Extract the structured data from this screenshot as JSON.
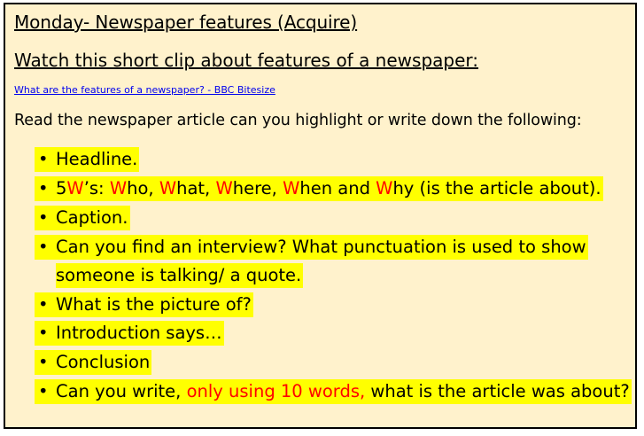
{
  "title": "Monday- Newspaper features (Acquire)",
  "subtitle": "Watch this short clip about features of a newspaper:",
  "link_text": "What are the features of a newspaper? - BBC Bitesize",
  "instruction": "Read the newspaper article can you highlight or write down the following:",
  "bullet_symbol": "•",
  "bullets": {
    "headline": "Headline.",
    "five_ws": {
      "n5": "5",
      "w1": "W",
      "s1": "’s: ",
      "w2": "W",
      "t2": "ho, ",
      "w3": "W",
      "t3": "hat, ",
      "w4": "W",
      "t4": "here, ",
      "w5": "W",
      "t5": "hen and ",
      "w6": "W",
      "t6": "hy (is the article about)."
    },
    "caption": "Caption.",
    "interview_line1": "Can you find an interview? What punctuation is used to show",
    "interview_line2": "someone is talking/ a quote.",
    "picture": "What is the picture of?",
    "introduction": "Introduction says…",
    "conclusion": "Conclusion",
    "summary": {
      "part1": "Can you write, ",
      "part2": "only using 10 words,",
      "part3": " what is the article was about?"
    }
  },
  "colors": {
    "background": "#fff2cc",
    "highlight": "#ffff00",
    "accent_red": "#ff0000",
    "link": "#0000ee"
  }
}
